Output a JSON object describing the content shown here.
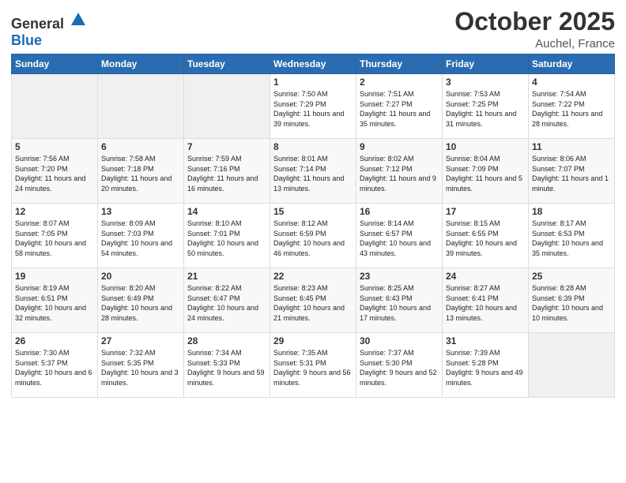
{
  "header": {
    "logo_general": "General",
    "logo_blue": "Blue",
    "month": "October 2025",
    "location": "Auchel, France"
  },
  "weekdays": [
    "Sunday",
    "Monday",
    "Tuesday",
    "Wednesday",
    "Thursday",
    "Friday",
    "Saturday"
  ],
  "weeks": [
    [
      {
        "day": "",
        "sunrise": "",
        "sunset": "",
        "daylight": ""
      },
      {
        "day": "",
        "sunrise": "",
        "sunset": "",
        "daylight": ""
      },
      {
        "day": "",
        "sunrise": "",
        "sunset": "",
        "daylight": ""
      },
      {
        "day": "1",
        "sunrise": "Sunrise: 7:50 AM",
        "sunset": "Sunset: 7:29 PM",
        "daylight": "Daylight: 11 hours and 39 minutes."
      },
      {
        "day": "2",
        "sunrise": "Sunrise: 7:51 AM",
        "sunset": "Sunset: 7:27 PM",
        "daylight": "Daylight: 11 hours and 35 minutes."
      },
      {
        "day": "3",
        "sunrise": "Sunrise: 7:53 AM",
        "sunset": "Sunset: 7:25 PM",
        "daylight": "Daylight: 11 hours and 31 minutes."
      },
      {
        "day": "4",
        "sunrise": "Sunrise: 7:54 AM",
        "sunset": "Sunset: 7:22 PM",
        "daylight": "Daylight: 11 hours and 28 minutes."
      }
    ],
    [
      {
        "day": "5",
        "sunrise": "Sunrise: 7:56 AM",
        "sunset": "Sunset: 7:20 PM",
        "daylight": "Daylight: 11 hours and 24 minutes."
      },
      {
        "day": "6",
        "sunrise": "Sunrise: 7:58 AM",
        "sunset": "Sunset: 7:18 PM",
        "daylight": "Daylight: 11 hours and 20 minutes."
      },
      {
        "day": "7",
        "sunrise": "Sunrise: 7:59 AM",
        "sunset": "Sunset: 7:16 PM",
        "daylight": "Daylight: 11 hours and 16 minutes."
      },
      {
        "day": "8",
        "sunrise": "Sunrise: 8:01 AM",
        "sunset": "Sunset: 7:14 PM",
        "daylight": "Daylight: 11 hours and 13 minutes."
      },
      {
        "day": "9",
        "sunrise": "Sunrise: 8:02 AM",
        "sunset": "Sunset: 7:12 PM",
        "daylight": "Daylight: 11 hours and 9 minutes."
      },
      {
        "day": "10",
        "sunrise": "Sunrise: 8:04 AM",
        "sunset": "Sunset: 7:09 PM",
        "daylight": "Daylight: 11 hours and 5 minutes."
      },
      {
        "day": "11",
        "sunrise": "Sunrise: 8:06 AM",
        "sunset": "Sunset: 7:07 PM",
        "daylight": "Daylight: 11 hours and 1 minute."
      }
    ],
    [
      {
        "day": "12",
        "sunrise": "Sunrise: 8:07 AM",
        "sunset": "Sunset: 7:05 PM",
        "daylight": "Daylight: 10 hours and 58 minutes."
      },
      {
        "day": "13",
        "sunrise": "Sunrise: 8:09 AM",
        "sunset": "Sunset: 7:03 PM",
        "daylight": "Daylight: 10 hours and 54 minutes."
      },
      {
        "day": "14",
        "sunrise": "Sunrise: 8:10 AM",
        "sunset": "Sunset: 7:01 PM",
        "daylight": "Daylight: 10 hours and 50 minutes."
      },
      {
        "day": "15",
        "sunrise": "Sunrise: 8:12 AM",
        "sunset": "Sunset: 6:59 PM",
        "daylight": "Daylight: 10 hours and 46 minutes."
      },
      {
        "day": "16",
        "sunrise": "Sunrise: 8:14 AM",
        "sunset": "Sunset: 6:57 PM",
        "daylight": "Daylight: 10 hours and 43 minutes."
      },
      {
        "day": "17",
        "sunrise": "Sunrise: 8:15 AM",
        "sunset": "Sunset: 6:55 PM",
        "daylight": "Daylight: 10 hours and 39 minutes."
      },
      {
        "day": "18",
        "sunrise": "Sunrise: 8:17 AM",
        "sunset": "Sunset: 6:53 PM",
        "daylight": "Daylight: 10 hours and 35 minutes."
      }
    ],
    [
      {
        "day": "19",
        "sunrise": "Sunrise: 8:19 AM",
        "sunset": "Sunset: 6:51 PM",
        "daylight": "Daylight: 10 hours and 32 minutes."
      },
      {
        "day": "20",
        "sunrise": "Sunrise: 8:20 AM",
        "sunset": "Sunset: 6:49 PM",
        "daylight": "Daylight: 10 hours and 28 minutes."
      },
      {
        "day": "21",
        "sunrise": "Sunrise: 8:22 AM",
        "sunset": "Sunset: 6:47 PM",
        "daylight": "Daylight: 10 hours and 24 minutes."
      },
      {
        "day": "22",
        "sunrise": "Sunrise: 8:23 AM",
        "sunset": "Sunset: 6:45 PM",
        "daylight": "Daylight: 10 hours and 21 minutes."
      },
      {
        "day": "23",
        "sunrise": "Sunrise: 8:25 AM",
        "sunset": "Sunset: 6:43 PM",
        "daylight": "Daylight: 10 hours and 17 minutes."
      },
      {
        "day": "24",
        "sunrise": "Sunrise: 8:27 AM",
        "sunset": "Sunset: 6:41 PM",
        "daylight": "Daylight: 10 hours and 13 minutes."
      },
      {
        "day": "25",
        "sunrise": "Sunrise: 8:28 AM",
        "sunset": "Sunset: 6:39 PM",
        "daylight": "Daylight: 10 hours and 10 minutes."
      }
    ],
    [
      {
        "day": "26",
        "sunrise": "Sunrise: 7:30 AM",
        "sunset": "Sunset: 5:37 PM",
        "daylight": "Daylight: 10 hours and 6 minutes."
      },
      {
        "day": "27",
        "sunrise": "Sunrise: 7:32 AM",
        "sunset": "Sunset: 5:35 PM",
        "daylight": "Daylight: 10 hours and 3 minutes."
      },
      {
        "day": "28",
        "sunrise": "Sunrise: 7:34 AM",
        "sunset": "Sunset: 5:33 PM",
        "daylight": "Daylight: 9 hours and 59 minutes."
      },
      {
        "day": "29",
        "sunrise": "Sunrise: 7:35 AM",
        "sunset": "Sunset: 5:31 PM",
        "daylight": "Daylight: 9 hours and 56 minutes."
      },
      {
        "day": "30",
        "sunrise": "Sunrise: 7:37 AM",
        "sunset": "Sunset: 5:30 PM",
        "daylight": "Daylight: 9 hours and 52 minutes."
      },
      {
        "day": "31",
        "sunrise": "Sunrise: 7:39 AM",
        "sunset": "Sunset: 5:28 PM",
        "daylight": "Daylight: 9 hours and 49 minutes."
      },
      {
        "day": "",
        "sunrise": "",
        "sunset": "",
        "daylight": ""
      }
    ]
  ]
}
